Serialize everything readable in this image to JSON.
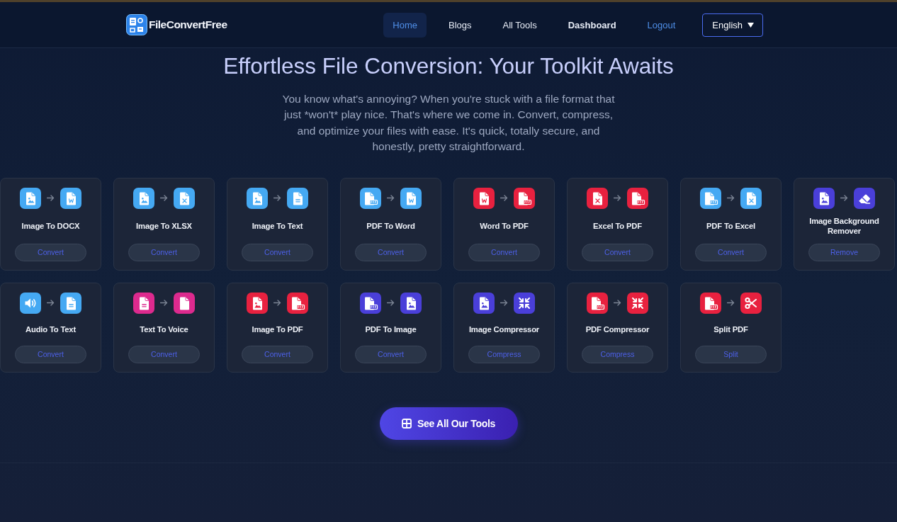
{
  "header": {
    "logo": {
      "text": "FileConvertFree"
    },
    "nav": [
      {
        "label": "Home",
        "selected": true,
        "kind": "plain"
      },
      {
        "label": "Blogs",
        "selected": false,
        "kind": "plain"
      },
      {
        "label": "All Tools",
        "selected": false,
        "kind": "plain"
      },
      {
        "label": "Dashboard",
        "selected": false,
        "kind": "bold"
      },
      {
        "label": "Logout",
        "selected": false,
        "kind": "accent"
      }
    ],
    "language_select": {
      "value": "English"
    }
  },
  "hero": {
    "title": "Effortless File Conversion: Your Toolkit Awaits",
    "description": "You know what's annoying? When you're stuck with a file format that just *won't* play nice. That's where we come in. Convert, compress, and optimize your files with ease. It's quick, totally secure, and honestly, pretty straightforward."
  },
  "tools": [
    {
      "name": "Image To DOCX",
      "action": "Convert",
      "from": {
        "kind": "image",
        "color": "#45a9f3"
      },
      "to": {
        "kind": "word",
        "color": "#45a9f3"
      }
    },
    {
      "name": "Image To XLSX",
      "action": "Convert",
      "from": {
        "kind": "image",
        "color": "#45a9f3"
      },
      "to": {
        "kind": "excel",
        "color": "#45a9f3"
      }
    },
    {
      "name": "Image To Text",
      "action": "Convert",
      "from": {
        "kind": "image",
        "color": "#45a9f3"
      },
      "to": {
        "kind": "text",
        "color": "#45a9f3"
      }
    },
    {
      "name": "PDF To Word",
      "action": "Convert",
      "from": {
        "kind": "pdf",
        "color": "#45a9f3"
      },
      "to": {
        "kind": "word",
        "color": "#45a9f3"
      }
    },
    {
      "name": "Word To PDF",
      "action": "Convert",
      "from": {
        "kind": "word",
        "color": "#e8213f"
      },
      "to": {
        "kind": "pdf",
        "color": "#e8213f"
      }
    },
    {
      "name": "Excel To PDF",
      "action": "Convert",
      "from": {
        "kind": "excel",
        "color": "#e8213f"
      },
      "to": {
        "kind": "pdf",
        "color": "#e8213f"
      }
    },
    {
      "name": "PDF To Excel",
      "action": "Convert",
      "from": {
        "kind": "pdf",
        "color": "#45a9f3"
      },
      "to": {
        "kind": "excel",
        "color": "#45a9f3"
      }
    },
    {
      "name": "Image Background Remover",
      "action": "Remove",
      "from": {
        "kind": "image",
        "color": "#4a3fd9"
      },
      "to": {
        "kind": "eraser",
        "color": "#4a3fd9"
      }
    },
    {
      "name": "Audio To Text",
      "action": "Convert",
      "from": {
        "kind": "audio",
        "color": "#45a9f3"
      },
      "to": {
        "kind": "text",
        "color": "#45a9f3"
      }
    },
    {
      "name": "Text To Voice",
      "action": "Convert",
      "from": {
        "kind": "text",
        "color": "#dd2a8e"
      },
      "to": {
        "kind": "blank",
        "color": "#dd2a8e"
      }
    },
    {
      "name": "Image To PDF",
      "action": "Convert",
      "from": {
        "kind": "image",
        "color": "#e8213f"
      },
      "to": {
        "kind": "pdf",
        "color": "#e8213f"
      }
    },
    {
      "name": "PDF To Image",
      "action": "Convert",
      "from": {
        "kind": "pdf",
        "color": "#4a3fd9"
      },
      "to": {
        "kind": "image",
        "color": "#4a3fd9"
      }
    },
    {
      "name": "Image Compressor",
      "action": "Compress",
      "from": {
        "kind": "image",
        "color": "#4a3fd9"
      },
      "to": {
        "kind": "compress",
        "color": "#4a3fd9"
      }
    },
    {
      "name": "PDF Compressor",
      "action": "Compress",
      "from": {
        "kind": "pdf",
        "color": "#e8213f"
      },
      "to": {
        "kind": "compress",
        "color": "#e8213f"
      }
    },
    {
      "name": "Split PDF",
      "action": "Split",
      "from": {
        "kind": "pdf",
        "color": "#e8213f"
      },
      "to": {
        "kind": "scissors",
        "color": "#e8213f"
      }
    }
  ],
  "see_all_button": {
    "label": "See All Our Tools"
  }
}
